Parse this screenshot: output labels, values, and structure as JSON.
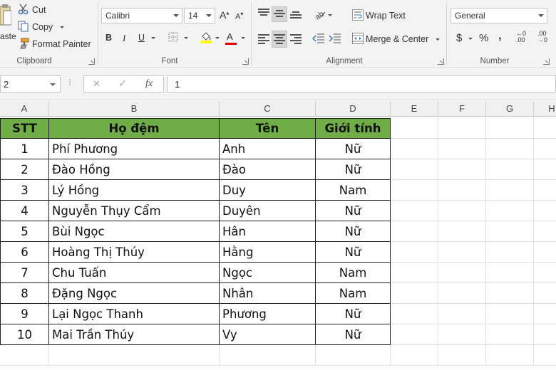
{
  "ribbon": {
    "clipboard": {
      "paste_label": "aste",
      "cut_label": "Cut",
      "copy_label": "Copy",
      "format_painter_label": "Format Painter",
      "group_label": "Clipboard"
    },
    "font": {
      "font_name": "Calibri",
      "font_size": "14",
      "grow_label": "A",
      "shrink_label": "A",
      "bold_label": "B",
      "italic_label": "I",
      "underline_label": "U",
      "font_color_label": "A",
      "group_label": "Font",
      "fill_color": "#ffff00",
      "font_color": "#e00000"
    },
    "alignment": {
      "wrap_text_label": "Wrap Text",
      "merge_center_label": "Merge & Center",
      "group_label": "Alignment"
    },
    "number": {
      "format_value": "General",
      "currency_label": "$",
      "percent_label": "%",
      "comma_label": ",",
      "inc_decimal_label": ".00",
      "dec_decimal_label": ".00",
      "group_label": "Number"
    }
  },
  "formula_bar": {
    "name_box": "2",
    "fx_label": "fx",
    "cancel_icon": "✕",
    "enter_icon": "✓",
    "value": "1"
  },
  "columns": [
    "A",
    "B",
    "C",
    "D",
    "E",
    "F",
    "G",
    "H"
  ],
  "table": {
    "header_color": "#70ad47",
    "headers": [
      "STT",
      "Họ đệm",
      "Tên",
      "Giới tính"
    ],
    "rows": [
      [
        "1",
        "Phí Phương",
        "Anh",
        "Nữ"
      ],
      [
        "2",
        "Đào Hồng",
        "Đào",
        "Nữ"
      ],
      [
        "3",
        "Lý Hồng",
        "Duy",
        "Nam"
      ],
      [
        "4",
        "Nguyễn Thụy Cẩm",
        "Duyên",
        "Nữ"
      ],
      [
        "5",
        "Bùi Ngọc",
        "Hân",
        "Nữ"
      ],
      [
        "6",
        "Hoàng Thị Thúy",
        "Hằng",
        "Nữ"
      ],
      [
        "7",
        "Chu Tuấn",
        "Ngọc",
        "Nam"
      ],
      [
        "8",
        "Đặng Ngọc",
        "Nhân",
        "Nam"
      ],
      [
        "9",
        "Lại Ngọc Thanh",
        "Phương",
        "Nữ"
      ],
      [
        "10",
        "Mai Trần Thúy",
        "Vy",
        "Nữ"
      ]
    ]
  }
}
